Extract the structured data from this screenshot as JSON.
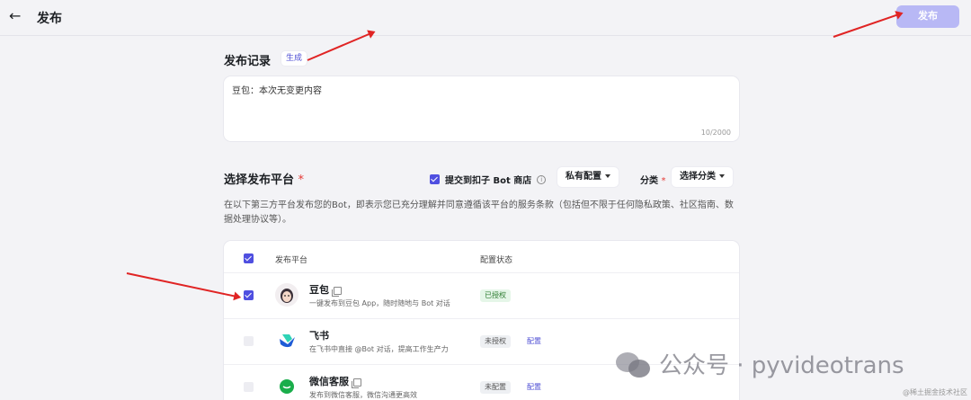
{
  "header": {
    "back_icon": "arrow-left-icon",
    "title": "发布",
    "publish_label": "发布"
  },
  "record": {
    "title": "发布记录",
    "generate_label": "生成",
    "textarea_value": "豆包：本次无变更内容",
    "counter": "10/2000"
  },
  "platform": {
    "title": "选择发布平台",
    "required_mark": "*",
    "store_label": "提交到扣子 Bot 商店",
    "private_config_label": "私有配置",
    "category_label": "分类",
    "category_select_label": "选择分类",
    "description": "在以下第三方平台发布您的Bot，即表示您已充分理解并同意遵循该平台的服务条款（包括但不限于任何隐私政策、社区指南、数据处理协议等）。"
  },
  "table": {
    "headers": [
      "发布平台",
      "配置状态"
    ],
    "rows": [
      {
        "name": "豆包",
        "desc": "一键发布到豆包 App，随时随地与 Bot 对话",
        "status": "已授权",
        "config": "",
        "checked": true
      },
      {
        "name": "飞书",
        "desc": "在飞书中直接 @Bot 对话，提高工作生产力",
        "status": "未授权",
        "config": "配置",
        "checked": false
      },
      {
        "name": "微信客服",
        "desc": "发布到微信客服，微信沟通更高效",
        "status": "未配置",
        "config": "配置",
        "checked": false
      }
    ]
  },
  "watermark": {
    "text": "公众号 · pyvideotrans",
    "small": "@稀土掘金技术社区"
  },
  "colors": {
    "accent": "#4f4fe0",
    "publish_button": "#b8b8f5",
    "arrow": "#e02424"
  }
}
